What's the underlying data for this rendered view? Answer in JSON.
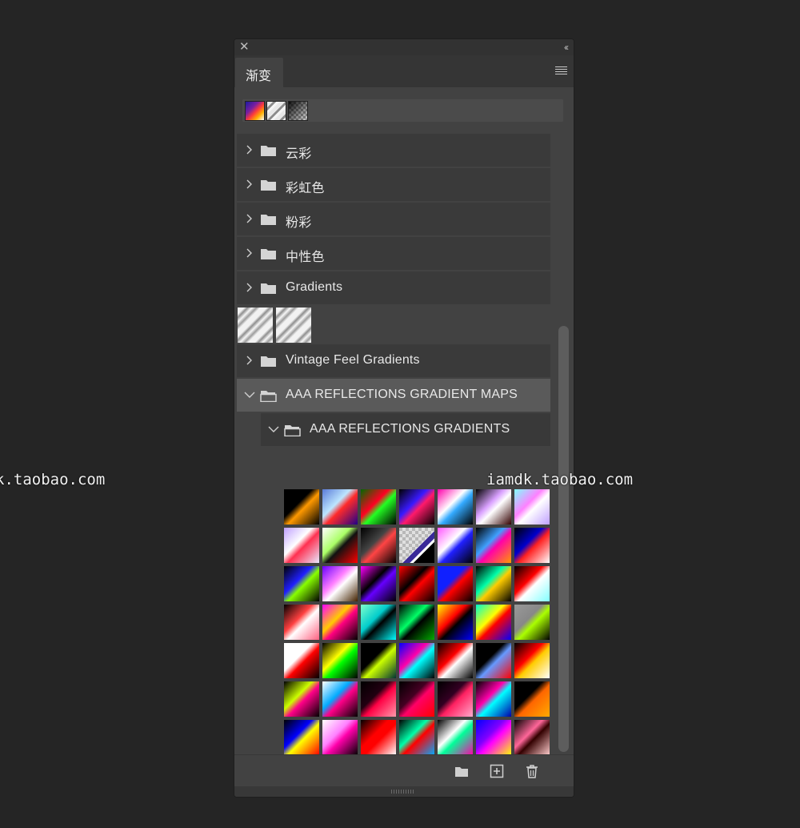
{
  "watermarks": [
    "k.taobao.com",
    "iamdk.taobao.com"
  ],
  "panel": {
    "title_bar": {
      "close_icon": "close-icon",
      "collapse_icon": "collapse-double-chevron-icon"
    },
    "tab": {
      "label": "渐变"
    },
    "menu_icon": "panel-menu-icon",
    "recent_presets": [
      "recent-gradient-1",
      "recent-gradient-2",
      "recent-gradient-3"
    ],
    "folders": [
      {
        "label": "云彩",
        "expanded": false
      },
      {
        "label": "彩虹色",
        "expanded": false
      },
      {
        "label": "粉彩",
        "expanded": false
      },
      {
        "label": "中性色",
        "expanded": false
      },
      {
        "label": "Gradients",
        "expanded": false
      },
      {
        "label": "Vintage Feel Gradients",
        "expanded": false
      },
      {
        "label": "AAA REFLECTIONS GRADIENT MAPS",
        "expanded": true,
        "selected": true
      },
      {
        "label": "AAA REFLECTIONS GRADIENTS",
        "expanded": true,
        "nested": true
      }
    ],
    "loose_swatch_count": 2,
    "gradient_swatch_count": 50,
    "bottom_actions": [
      "new-group-folder-icon",
      "new-gradient-plus-icon",
      "delete-trash-icon"
    ]
  },
  "colors": {
    "background": "#252525",
    "panel": "#424242",
    "row": "#3a3a3a",
    "selected_row": "#5a5a5a"
  }
}
